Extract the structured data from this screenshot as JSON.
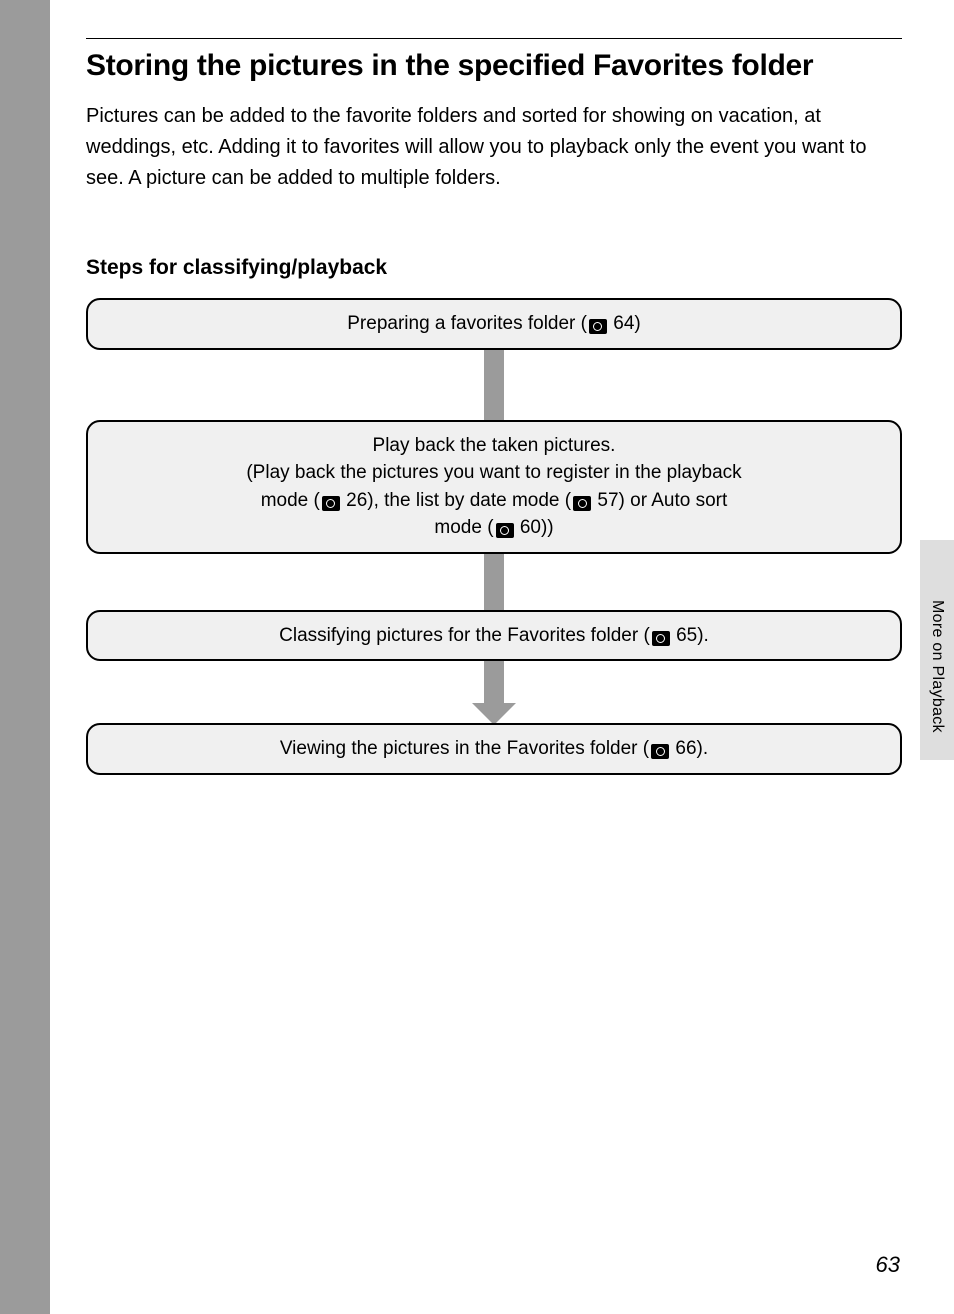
{
  "title": "Storing the pictures in the specified Favorites folder",
  "intro": "Pictures can be added to the favorite folders and sorted for showing on vacation, at weddings, etc. Adding it to favorites will allow you to playback only the event you want to see. A picture can be added to multiple folders.",
  "steps_heading": "Steps for classifying/playback",
  "steps": {
    "s1": {
      "pre": "Preparing a favorites folder (",
      "ref": "64",
      "post": ")"
    },
    "s2": {
      "l1": "Play back the taken pictures.",
      "l2a": "(Play back the pictures you want to register in the playback",
      "l3_pre": "mode (",
      "l3_ref1": "26",
      "l3_mid": "), the list by date mode (",
      "l3_ref2": "57",
      "l3_post": ") or Auto sort",
      "l4_pre": "mode (",
      "l4_ref": "60",
      "l4_post": "))"
    },
    "s3": {
      "pre": "Classifying pictures for the Favorites folder (",
      "ref": "65",
      "post": ")."
    },
    "s4": {
      "pre": "Viewing the pictures in the Favorites folder (",
      "ref": "66",
      "post": ")."
    }
  },
  "side_label": "More on Playback",
  "page_number": "63"
}
